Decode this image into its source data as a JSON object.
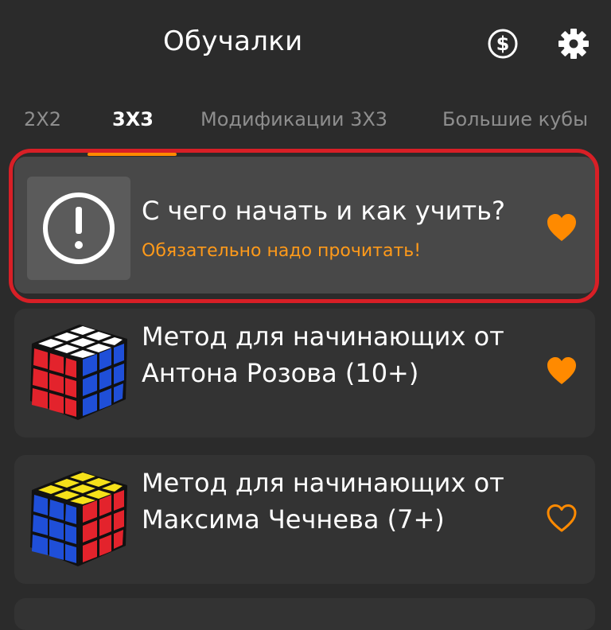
{
  "header": {
    "title": "Обучалки",
    "icons": [
      "dollar-coin-icon",
      "gear-icon"
    ]
  },
  "tabs": [
    {
      "label": "2X2",
      "active": false
    },
    {
      "label": "3X3",
      "active": true
    },
    {
      "label": "Модификации 3X3",
      "active": false
    },
    {
      "label": "Большие кубы",
      "active": false
    }
  ],
  "colors": {
    "accent": "#ff8a00",
    "highlight_border": "#d81f26",
    "background": "#2b2b2b",
    "card": "#333333",
    "card_highlighted": "#484848"
  },
  "cards": [
    {
      "title": "С чего начать и как учить?",
      "subtitle": "Обязательно надо прочитать!",
      "icon": "exclamation-circle-icon",
      "favorite": true,
      "highlighted": true
    },
    {
      "title_line1": "Метод для начинающих от",
      "title_line2": "Антона Розова (10+)",
      "icon": "rubiks-cube-red-top-white",
      "favorite": true
    },
    {
      "title_line1": "Метод для начинающих от",
      "title_line2": "Максима Чечнева (7+)",
      "icon": "rubiks-cube-yellow-top",
      "favorite": false
    }
  ]
}
